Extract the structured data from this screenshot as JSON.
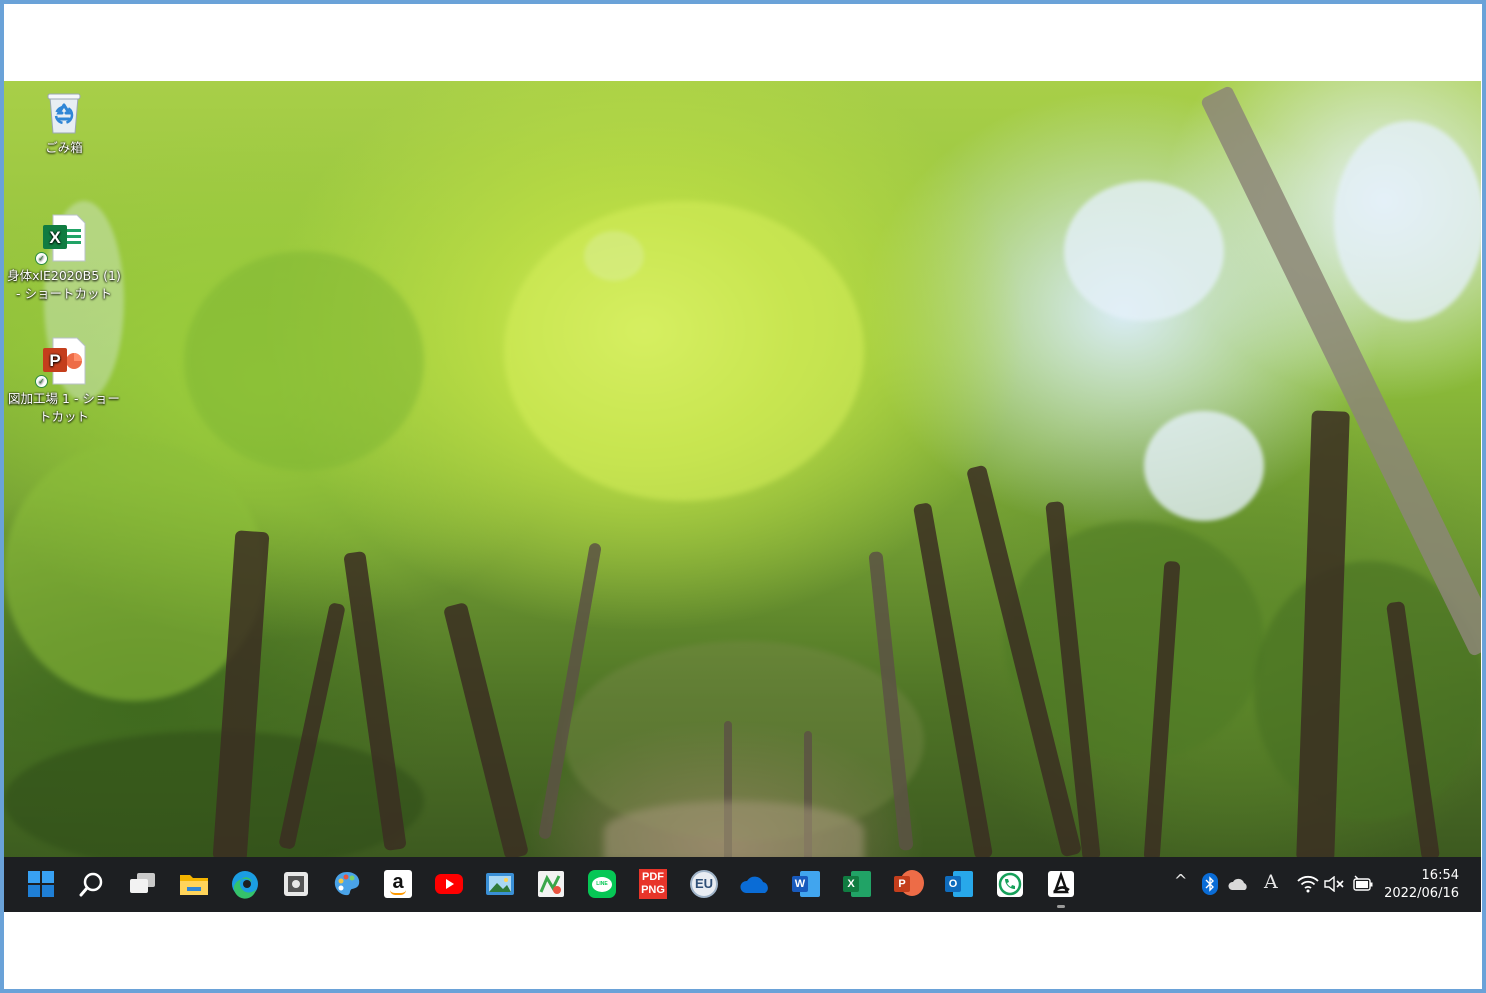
{
  "desktop_icons": [
    {
      "id": "recycle-bin",
      "label": "ごみ箱",
      "icon": "recycle-bin-icon"
    },
    {
      "id": "excel-shortcut",
      "label": "身体xlE2020B5 (1) - ショートカット",
      "icon": "excel-file-icon"
    },
    {
      "id": "powerpoint-shortcut",
      "label": "図加工場 1 - ショートカット",
      "icon": "powerpoint-file-icon"
    }
  ],
  "taskbar": {
    "apps": [
      {
        "name": "start-button",
        "icon": "windows-logo-icon"
      },
      {
        "name": "search-button",
        "icon": "search-icon"
      },
      {
        "name": "task-view-button",
        "icon": "task-view-icon"
      },
      {
        "name": "file-explorer-button",
        "icon": "folder-icon"
      },
      {
        "name": "edge-button",
        "icon": "edge-icon"
      },
      {
        "name": "app-6-button",
        "icon": "settings-app-icon"
      },
      {
        "name": "paint-button",
        "icon": "paint-palette-icon"
      },
      {
        "name": "amazon-button",
        "icon": "amazon-icon",
        "text": "a"
      },
      {
        "name": "youtube-button",
        "icon": "youtube-icon"
      },
      {
        "name": "photos-button",
        "icon": "photo-viewer-icon"
      },
      {
        "name": "app-11-button",
        "icon": "map-app-icon"
      },
      {
        "name": "line-button",
        "icon": "line-chat-icon",
        "text": "LINE"
      },
      {
        "name": "pdf-png-button",
        "icon": "pdf-png-icon",
        "text_top": "PDF",
        "text_bottom": "PNG"
      },
      {
        "name": "eu-button",
        "icon": "eu-app-icon",
        "text": "EU"
      },
      {
        "name": "onedrive-button",
        "icon": "onedrive-cloud-icon"
      },
      {
        "name": "word-button",
        "icon": "word-icon",
        "text": "W"
      },
      {
        "name": "excel-button",
        "icon": "excel-icon",
        "text": "X"
      },
      {
        "name": "powerpoint-button",
        "icon": "powerpoint-icon",
        "text": "P"
      },
      {
        "name": "outlook-button",
        "icon": "outlook-icon",
        "text": "O"
      },
      {
        "name": "app-20-button",
        "icon": "phone-app-icon"
      },
      {
        "name": "app-21-button",
        "icon": "draw-app-icon",
        "active": true
      }
    ],
    "tray": {
      "chevron": "^",
      "ime": "A",
      "icons": [
        "chevron-up-icon",
        "bluetooth-icon",
        "onedrive-tray-icon",
        "ime-icon",
        "wifi-icon",
        "volume-muted-icon",
        "battery-icon"
      ]
    },
    "clock": {
      "time": "16:54",
      "date": "2022/06/16"
    }
  },
  "colors": {
    "frame_border": "#6aa2d8",
    "taskbar": "#1d1f22",
    "accent_blue": "#0078d4"
  }
}
